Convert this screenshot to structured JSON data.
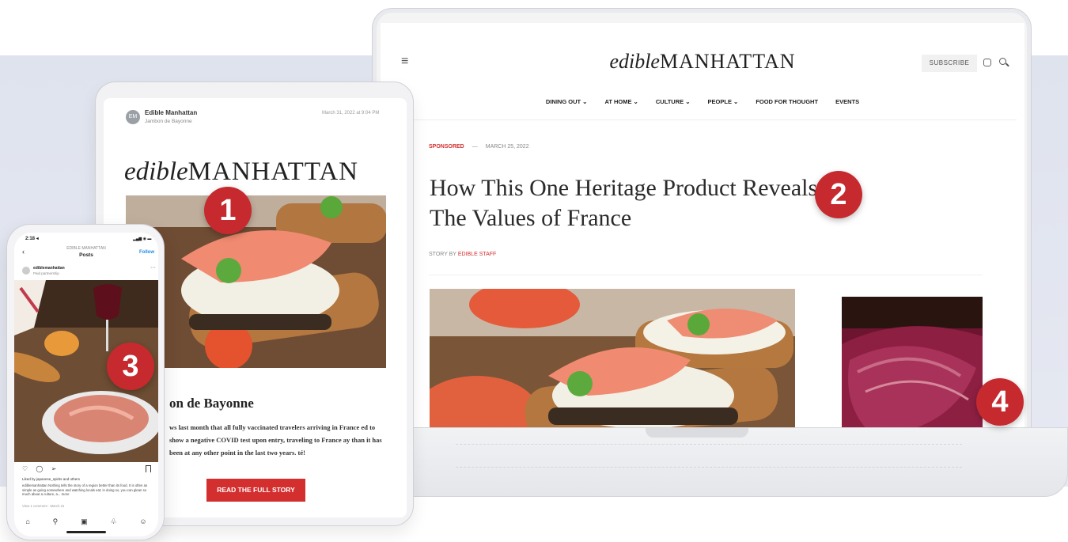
{
  "laptop": {
    "logo_italic": "edible",
    "logo_caps": "MANHATTAN",
    "subscribe_label": "SUBSCRIBE",
    "nav": [
      "DINING OUT ⌄",
      "AT HOME ⌄",
      "CULTURE ⌄",
      "PEOPLE ⌄",
      "FOOD FOR THOUGHT",
      "EVENTS"
    ],
    "article": {
      "tag": "SPONSORED",
      "dash": "—",
      "date": "MARCH 25, 2022",
      "headline": "How This One Heritage Product Reveals The Values of France",
      "byline_prefix": "STORY BY ",
      "byline_author": "EDIBLE STAFF"
    }
  },
  "tablet": {
    "avatar_initials": "EM",
    "sender": "Edible Manhattan",
    "subject": "Jambon de Bayonne",
    "date": "March 31, 2022 at 9:04 PM",
    "logo_italic": "edible",
    "logo_caps": "MANHATTAN",
    "title": "on de Bayonne",
    "body": "ws last month that all fully vaccinated travelers arriving in France ed to show a negative COVID test upon entry, traveling to France ay than it has been at any other point in the last two years. té!",
    "cta": "READ THE FULL STORY"
  },
  "phone": {
    "time": "2:18 ◂",
    "status": "▂▄▆ ◉ ▬",
    "back": "‹",
    "account_header": "EDIBLE MANHATTAN",
    "screen_title": "Posts",
    "follow": "Follow",
    "username": "ediblemanhattan",
    "partnership": "Paid partnership",
    "more": "···",
    "actions": "♡ ◯ ➢",
    "likes": "Liked by japanese_spirits and others",
    "caption": "ediblemanhattan Nothing tells the story of a region better than its food. It is often as simple as going somewhere and watching locals eat; in doing so, you can glean so much about a culture, a... more",
    "view_comments": "View 1 comment",
    "date": "March 31",
    "tabs": [
      "⌂",
      "⚲",
      "▣",
      "♧",
      "☺"
    ]
  },
  "badges": [
    "1",
    "2",
    "3",
    "4"
  ],
  "colors": {
    "accent_red": "#c62a2f",
    "background": "#e1e4ee",
    "link_red": "#d32f2f",
    "follow_blue": "#1e88e5"
  }
}
